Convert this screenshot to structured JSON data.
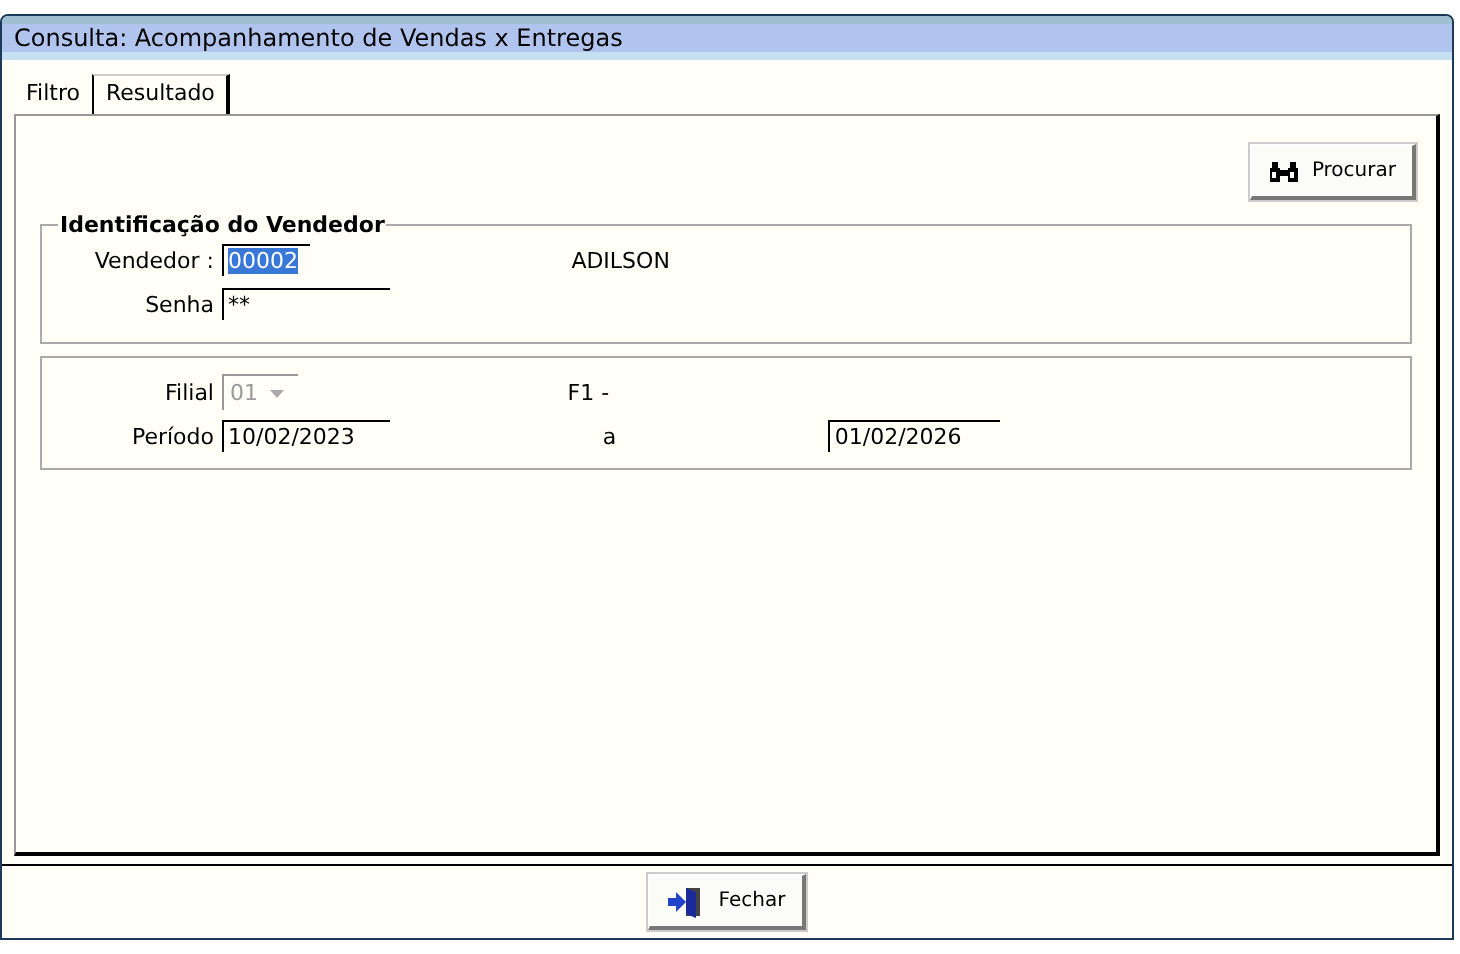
{
  "window": {
    "title": "Consulta: Acompanhamento de Vendas x Entregas"
  },
  "tabs": [
    {
      "label": "Filtro",
      "selected": true
    },
    {
      "label": "Resultado",
      "selected": false
    }
  ],
  "search_button": {
    "label": "Procurar"
  },
  "seller_group": {
    "title": "Identificação do Vendedor",
    "seller_label": "Vendedor :",
    "seller_code": "00002",
    "seller_code_highlighted": true,
    "seller_name": "ADILSON",
    "password_label": "Senha",
    "password": "**"
  },
  "filter_group": {
    "branch_label": "Filial",
    "branch": "01",
    "branch_disabled": true,
    "branch_name": "F1 -",
    "period_label": "Período",
    "period_from": "10/02/2023",
    "period_separator": "a",
    "period_to": "01/02/2026"
  },
  "close_button": {
    "label": "Fechar"
  }
}
